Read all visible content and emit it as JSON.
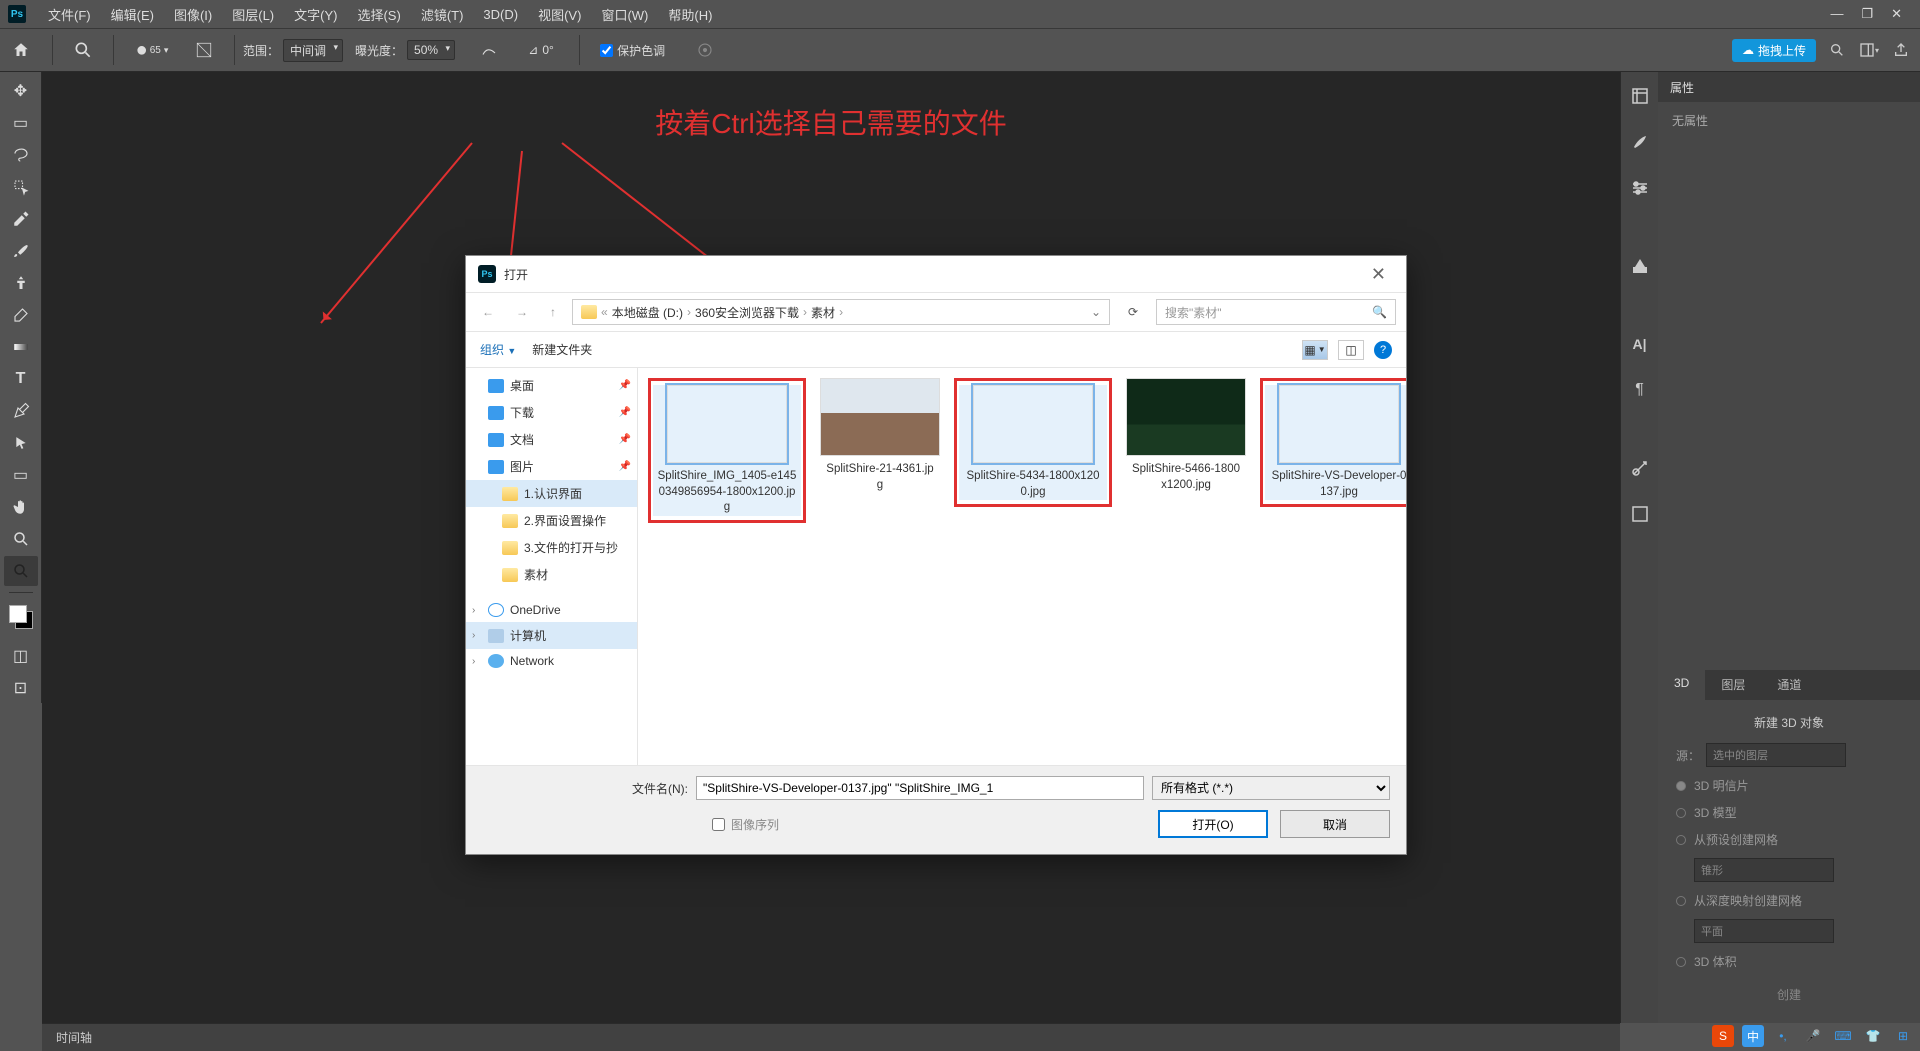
{
  "menu": {
    "items": [
      "文件(F)",
      "编辑(E)",
      "图像(I)",
      "图层(L)",
      "文字(Y)",
      "选择(S)",
      "滤镜(T)",
      "3D(D)",
      "视图(V)",
      "窗口(W)",
      "帮助(H)"
    ]
  },
  "optbar": {
    "brush_size": "65",
    "range_label": "范围：",
    "range_value": "中间调",
    "exposure_label": "曝光度：",
    "exposure_value": "50%",
    "angle_value": "0°",
    "protect_label": "保护色调",
    "cloud_label": "拖拽上传"
  },
  "hint": "按着Ctrl选择自己需要的文件",
  "panels": {
    "properties_title": "属性",
    "properties_empty": "无属性",
    "tabs": [
      "3D",
      "图层",
      "通道"
    ],
    "p3d": {
      "header": "新建 3D 对象",
      "source_label": "源：",
      "source_value": "选中的图层",
      "opts": [
        "3D 明信片",
        "3D 模型",
        "从预设创建网格",
        "从深度映射创建网格",
        "3D 体积"
      ],
      "preset1": "锥形",
      "preset2": "平面",
      "create": "创建"
    }
  },
  "status": {
    "timeline": "时间轴"
  },
  "dialog": {
    "title": "打开",
    "crumbs": [
      "本地磁盘 (D:)",
      "360安全浏览器下载",
      "素材"
    ],
    "search_ph": "搜索\"素材\"",
    "organize": "组织",
    "newfolder": "新建文件夹",
    "tree": [
      {
        "label": "桌面",
        "cls": "blue",
        "pin": true
      },
      {
        "label": "下载",
        "cls": "blue",
        "pin": true
      },
      {
        "label": "文档",
        "cls": "blue",
        "pin": true
      },
      {
        "label": "图片",
        "cls": "blue",
        "pin": true
      },
      {
        "label": "1.认识界面",
        "cls": "folder",
        "sub": true,
        "sel": true
      },
      {
        "label": "2.界面设置操作",
        "cls": "folder",
        "sub": true
      },
      {
        "label": "3.文件的打开与抄",
        "cls": "folder",
        "sub": true
      },
      {
        "label": "素材",
        "cls": "folder",
        "sub": true
      },
      {
        "label": "OneDrive",
        "cls": "cloud",
        "chev": true,
        "gap": true
      },
      {
        "label": "计算机",
        "cls": "drive",
        "chev": true,
        "sel2": true
      },
      {
        "label": "Network",
        "cls": "net",
        "chev": true
      }
    ],
    "files": [
      {
        "name": "SplitShire_IMG_1405-e1450349856954-1800x1200.jpg",
        "sel": true,
        "p": "p1",
        "box": true
      },
      {
        "name": "SplitShire-21-4361.jpg",
        "sel": false,
        "p": "p2",
        "box": false
      },
      {
        "name": "SplitShire-5434-1800x1200.jpg",
        "sel": true,
        "p": "p3",
        "box": true
      },
      {
        "name": "SplitShire-5466-1800x1200.jpg",
        "sel": false,
        "p": "p4",
        "box": false
      },
      {
        "name": "SplitShire-VS-Developer-0137.jpg",
        "sel": true,
        "p": "p5",
        "box": true
      }
    ],
    "filename_label": "文件名(N):",
    "filename_value": "\"SplitShire-VS-Developer-0137.jpg\" \"SplitShire_IMG_1",
    "filter": "所有格式 (*.*)",
    "seq": "图像序列",
    "open_btn": "打开(O)",
    "cancel_btn": "取消"
  },
  "ime": {
    "s": "S",
    "zh": "中"
  }
}
